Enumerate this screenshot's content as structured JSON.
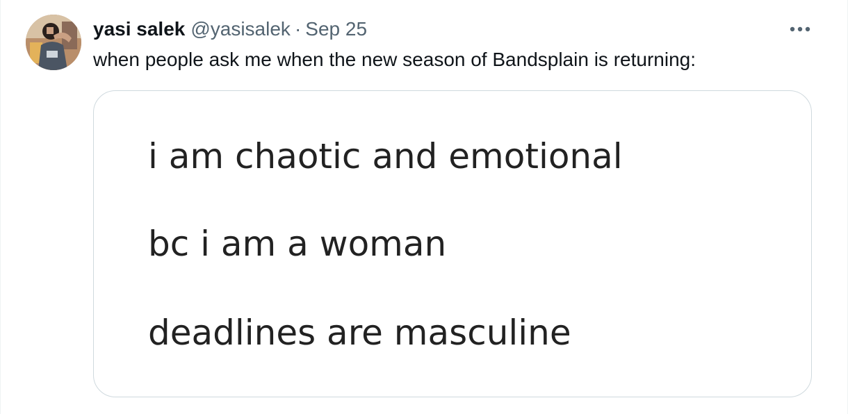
{
  "tweet": {
    "display_name": "yasi salek",
    "handle": "@yasisalek",
    "separator": "·",
    "date": "Sep 25",
    "text": "when people ask me when the new season of Bandsplain is returning:",
    "more_icon": "more-horizontal-icon",
    "avatar_icon": "avatar"
  },
  "media": {
    "lines": [
      "i am chaotic and emotional",
      "bc i am a woman",
      "deadlines are masculine"
    ]
  },
  "colors": {
    "primary_text": "#0f1419",
    "secondary_text": "#536471",
    "border": "#cfd9de",
    "media_text": "#222222"
  }
}
